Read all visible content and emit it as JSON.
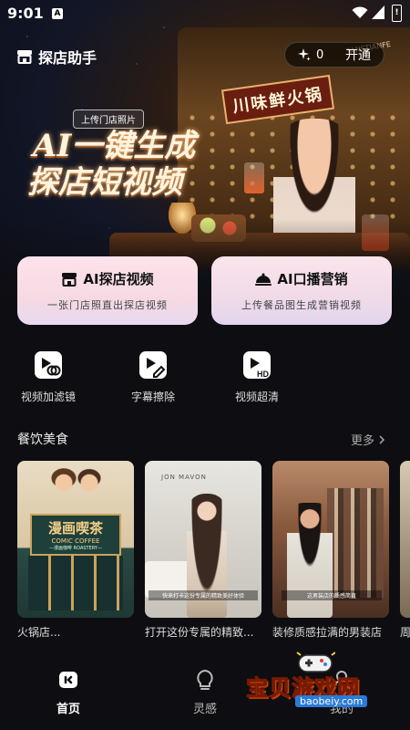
{
  "status_bar": {
    "time": "9:01",
    "notification_glyph": "A"
  },
  "header": {
    "app_title": "探店助手",
    "points": "0",
    "open_label": "开通"
  },
  "hero": {
    "upload_tag": "上传门店照片",
    "headline_line1": "AI一键生成",
    "headline_line2": "探店短视频",
    "sign_text": "川味鲜火锅",
    "sign_en": "TANSTIANFE"
  },
  "feature_cards": [
    {
      "title": "AI探店视频",
      "subtitle": "一张门店照直出探店视频",
      "icon": "store-icon"
    },
    {
      "title": "AI口播营销",
      "subtitle": "上传餐品图生成营销视频",
      "icon": "cloche-icon"
    }
  ],
  "tools": [
    {
      "label": "视频加滤镜",
      "icon": "video-filter-icon"
    },
    {
      "label": "字幕擦除",
      "icon": "subtitle-erase-icon"
    },
    {
      "label": "视频超清",
      "icon": "video-hd-icon"
    }
  ],
  "section": {
    "title": "餐饮美食",
    "more_label": "更多"
  },
  "videos": [
    {
      "caption": "火锅店...",
      "sign_main": "漫画喫茶",
      "sign_en": "COMIC COFFEE",
      "sign_sub": "—漫画咖啡 ROASTERY—"
    },
    {
      "caption": "打开这份专属的精致...",
      "brand": "JON MAVON",
      "subtitle": "快来打卡这份专属的精致美好体验"
    },
    {
      "caption": "装修质感拉满的男装店",
      "subtitle": "这男装店的质感简直"
    },
    {
      "caption": "周"
    }
  ],
  "nav": [
    {
      "label": "首页",
      "icon": "home-icon",
      "active": true
    },
    {
      "label": "灵感",
      "icon": "bulb-icon",
      "active": false
    },
    {
      "label": "我的",
      "icon": "profile-icon",
      "active": false
    }
  ],
  "watermark": {
    "text": "宝贝游戏网",
    "url": "baobeiy.com"
  },
  "colors": {
    "background": "#0e0e12",
    "card_pink": "#fde3ea",
    "watermark_yellow": "#ffd23a"
  }
}
